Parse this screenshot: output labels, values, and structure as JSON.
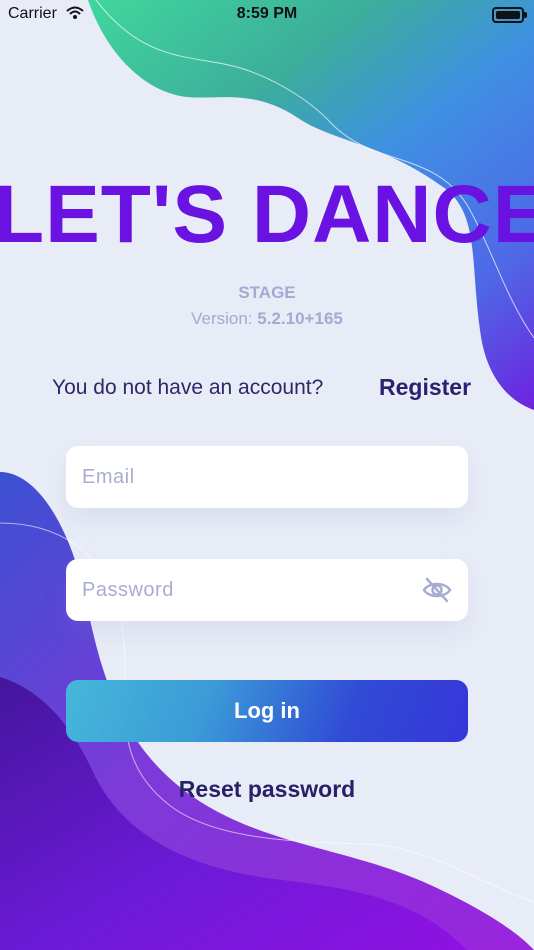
{
  "status_bar": {
    "carrier": "Carrier",
    "time": "8:59 PM"
  },
  "brand": {
    "logo_text": "LET'S DANCE"
  },
  "environment": {
    "stage": "STAGE",
    "version_label": "Version:",
    "version_value": "5.2.10+165"
  },
  "account": {
    "prompt": "You do not have an account?",
    "register_label": "Register"
  },
  "form": {
    "email_placeholder": "Email",
    "password_placeholder": "Password",
    "login_label": "Log in",
    "reset_label": "Reset password"
  },
  "colors": {
    "background": "#e8ecf6",
    "logo": "#6a12e2",
    "primary_text": "#2b2170",
    "placeholder": "#a8add0",
    "button_gradient_start": "#45b7da",
    "button_gradient_end": "#3636d8"
  },
  "icons": {
    "wifi": "wifi-icon",
    "battery": "battery-icon",
    "password_visibility": "eye-off-icon"
  }
}
